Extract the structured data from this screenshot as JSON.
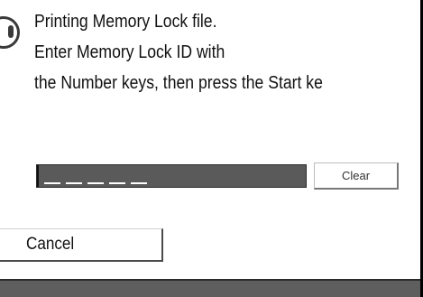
{
  "message": {
    "line1": "Printing Memory Lock file.",
    "line2": "Enter Memory Lock ID with",
    "line3": "the Number keys, then press the Start ke"
  },
  "id_field": {
    "slot_count": 5,
    "value": ""
  },
  "buttons": {
    "clear_label": "Clear",
    "cancel_label": "Cancel"
  },
  "icons": {
    "info": "info-icon"
  },
  "colors": {
    "id_field_bg": "#5a5a5a",
    "bottom_bar": "#5e5e5e",
    "frame": "#000000"
  }
}
